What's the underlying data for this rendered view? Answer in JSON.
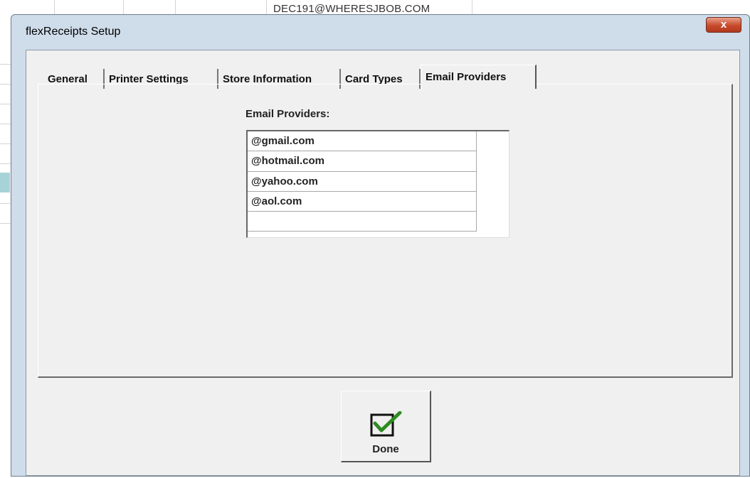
{
  "background": {
    "cell_text": "DEC191@WHERESJBOB.COM"
  },
  "window": {
    "title": "flexReceipts Setup",
    "close_glyph": "x"
  },
  "tabs": [
    {
      "label": "General",
      "active": false
    },
    {
      "label": "Printer Settings",
      "active": false
    },
    {
      "label": "Store Information",
      "active": false
    },
    {
      "label": "Card Types",
      "active": false
    },
    {
      "label": "Email Providers",
      "active": true
    }
  ],
  "email_providers": {
    "label": "Email Providers:",
    "items": [
      "@gmail.com",
      "@hotmail.com",
      "@yahoo.com",
      "@aol.com",
      ""
    ]
  },
  "done_button": {
    "label": "Done",
    "icon": "checkbox-checked-icon",
    "check_color": "#2e8b22"
  },
  "colors": {
    "close_button": "#c84a2c",
    "window_frame": "#cfdcea",
    "client_bg": "#f0f0f0"
  }
}
